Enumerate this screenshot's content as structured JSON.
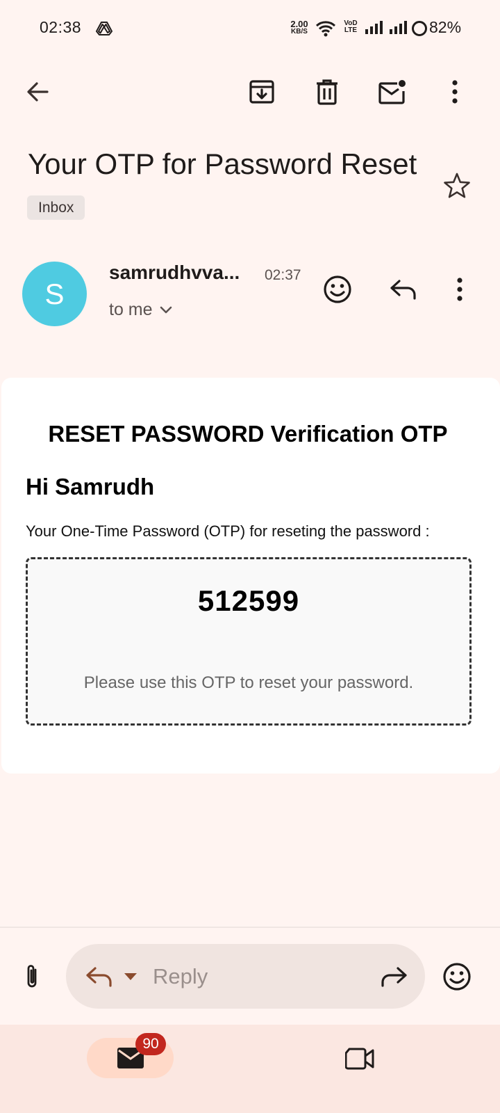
{
  "status_bar": {
    "time": "02:38",
    "net_speed_value": "2.00",
    "net_speed_unit": "KB/S",
    "volte_top": "VoD",
    "volte_bottom": "LTE",
    "battery": "82%"
  },
  "toolbar": {
    "back_icon": "arrow-back-icon",
    "archive_icon": "archive-icon",
    "delete_icon": "delete-icon",
    "unread_icon": "mark-unread-icon",
    "more_icon": "more-vert-icon"
  },
  "email": {
    "subject": "Your OTP for Password Reset",
    "label": "Inbox",
    "sender_initial": "S",
    "sender_name": "samrudhvva...",
    "time": "02:37",
    "recipient": "to me"
  },
  "body": {
    "title": "RESET PASSWORD Verification OTP",
    "greeting": "Hi Samrudh",
    "intro": "Your One-Time Password (OTP) for reseting the password :",
    "otp": "512599",
    "note": "Please use this OTP to reset your password."
  },
  "compose": {
    "reply_placeholder": "Reply"
  },
  "bottom_nav": {
    "mail_badge": "90"
  },
  "colors": {
    "background": "#fff4f1",
    "avatar": "#4fcbe1",
    "accent": "#8a4b2e",
    "badge": "#c2271e"
  }
}
